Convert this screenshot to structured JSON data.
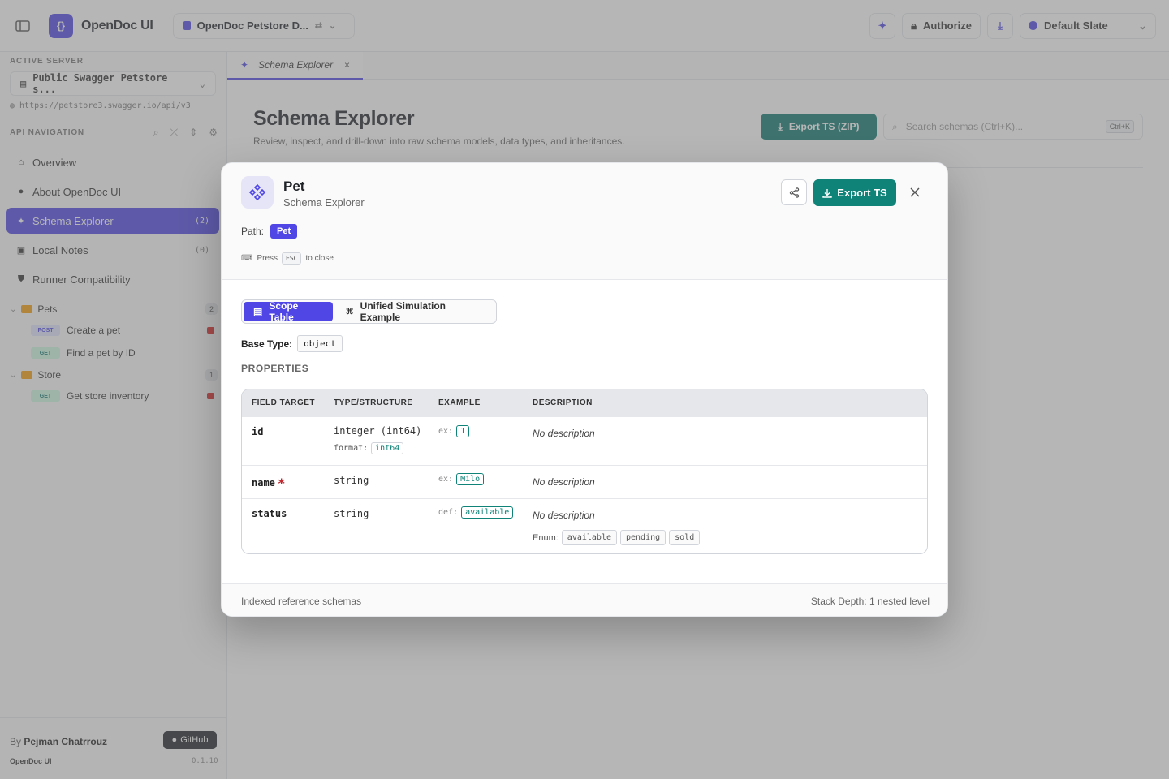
{
  "app": {
    "brand": "OpenDoc UI",
    "spec_name": "OpenDoc Petstore D...",
    "authorize_label": "Authorize",
    "theme_label": "Default Slate",
    "logo_glyph": "{}"
  },
  "sidebar": {
    "active_server_label": "ACTIVE SERVER",
    "server_name": "Public Swagger Petstore s...",
    "server_url": "https://petstore3.swagger.io/api/v3",
    "nav_label": "API NAVIGATION",
    "items": [
      {
        "label": "Overview",
        "count": ""
      },
      {
        "label": "About OpenDoc UI",
        "count": ""
      },
      {
        "label": "Schema Explorer",
        "count": "(2)"
      },
      {
        "label": "Local Notes",
        "count": "(0)"
      },
      {
        "label": "Runner Compatibility",
        "count": ""
      }
    ],
    "groups": [
      {
        "name": "Pets",
        "count": "2"
      },
      {
        "name": "Store",
        "count": "1"
      }
    ],
    "endpoints": [
      {
        "method": "POST",
        "label": "Create a pet"
      },
      {
        "method": "GET",
        "label": "Find a pet by ID"
      },
      {
        "method": "GET",
        "label": "Get store inventory"
      }
    ],
    "footer": {
      "by_prefix": "By",
      "author": "Pejman Chatrrouz",
      "github_label": "GitHub",
      "app_name": "OpenDoc UI",
      "version": "0.1.10"
    }
  },
  "main": {
    "tab_label": "Schema Explorer",
    "title": "Schema Explorer",
    "subtitle": "Review, inspect, and drill-down into raw schema models, data types, and inheritances.",
    "export_zip_label": "Export TS (ZIP)",
    "search_placeholder": "Search schemas (Ctrl+K)...",
    "search_kbd": "Ctrl+K"
  },
  "modal": {
    "title": "Pet",
    "subtitle": "Schema Explorer",
    "export_label": "Export TS",
    "path_label": "Path:",
    "path_value": "Pet",
    "esc_prefix": "Press",
    "esc_key": "ESC",
    "esc_suffix": "to close",
    "tabs": [
      "Scope Table",
      "Unified Simulation Example"
    ],
    "base_type_label": "Base Type:",
    "base_type": "object",
    "properties_label": "PROPERTIES",
    "columns": [
      "FIELD TARGET",
      "TYPE/STRUCTURE",
      "EXAMPLE",
      "DESCRIPTION"
    ],
    "rows": [
      {
        "field": "id",
        "required": false,
        "type": "integer (int64)",
        "format_label": "format:",
        "format": "int64",
        "example_prefix": "ex:",
        "example": "1",
        "description": "No description"
      },
      {
        "field": "name",
        "required": true,
        "required_mark": "*",
        "type": "string",
        "example_prefix": "ex:",
        "example": "Milo",
        "description": "No description"
      },
      {
        "field": "status",
        "required": false,
        "type": "string",
        "example_prefix": "def:",
        "example": "available",
        "description": "No description",
        "enum_label": "Enum:",
        "enum": [
          "available",
          "pending",
          "sold"
        ]
      }
    ],
    "footer_left": "Indexed reference schemas",
    "footer_right": "Stack Depth: 1 nested level"
  }
}
